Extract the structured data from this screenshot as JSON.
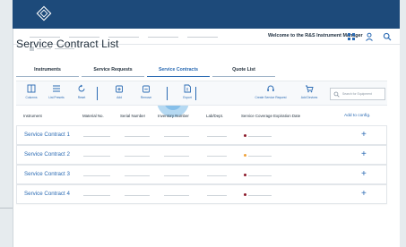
{
  "header": {
    "welcome_text": "Welcome to the R&S Instrument Manager",
    "logo_icon": "rs-diamond-logo",
    "icons": [
      "grid-icon",
      "user-icon",
      "search-icon"
    ],
    "brand_color": "#1d4a7a",
    "accent_color": "#2a6ab3"
  },
  "page": {
    "title": "Service Contract List"
  },
  "tabs": [
    {
      "label": "Instruments",
      "active": false
    },
    {
      "label": "Service Requests",
      "active": false
    },
    {
      "label": "Service Contracts",
      "active": true
    },
    {
      "label": "Quote List",
      "active": false
    }
  ],
  "toolbar": {
    "items": [
      {
        "label": "Columns",
        "icon": "columns-icon"
      },
      {
        "label": "List Presets",
        "icon": "list-icon"
      },
      {
        "label": "Reset",
        "icon": "reset-icon"
      },
      {
        "label": "Add",
        "icon": "add-icon"
      },
      {
        "label": "Remove",
        "icon": "remove-icon"
      },
      {
        "label": "Export",
        "icon": "export-icon"
      },
      {
        "label": "Create Service Request",
        "icon": "headset-icon"
      },
      {
        "label": "Add Devices",
        "icon": "cart-icon"
      }
    ],
    "search_placeholder": "Search for Equipment"
  },
  "table": {
    "headers": [
      "Instrument",
      "Material No.",
      "Serial Number",
      "Inventory Number",
      "Lab/Dept.",
      "Service Coverage Expiration Date"
    ],
    "add_label": "Add to config.",
    "rows": [
      {
        "name": "Service Contract 1",
        "status_color": "#8b1a2b"
      },
      {
        "name": "Service Contract 2",
        "status_color": "#f0a23a"
      },
      {
        "name": "Service Contract 3",
        "status_color": "#8b1a2b"
      },
      {
        "name": "Service Contract 4",
        "status_color": "#8b1a2b"
      }
    ]
  }
}
